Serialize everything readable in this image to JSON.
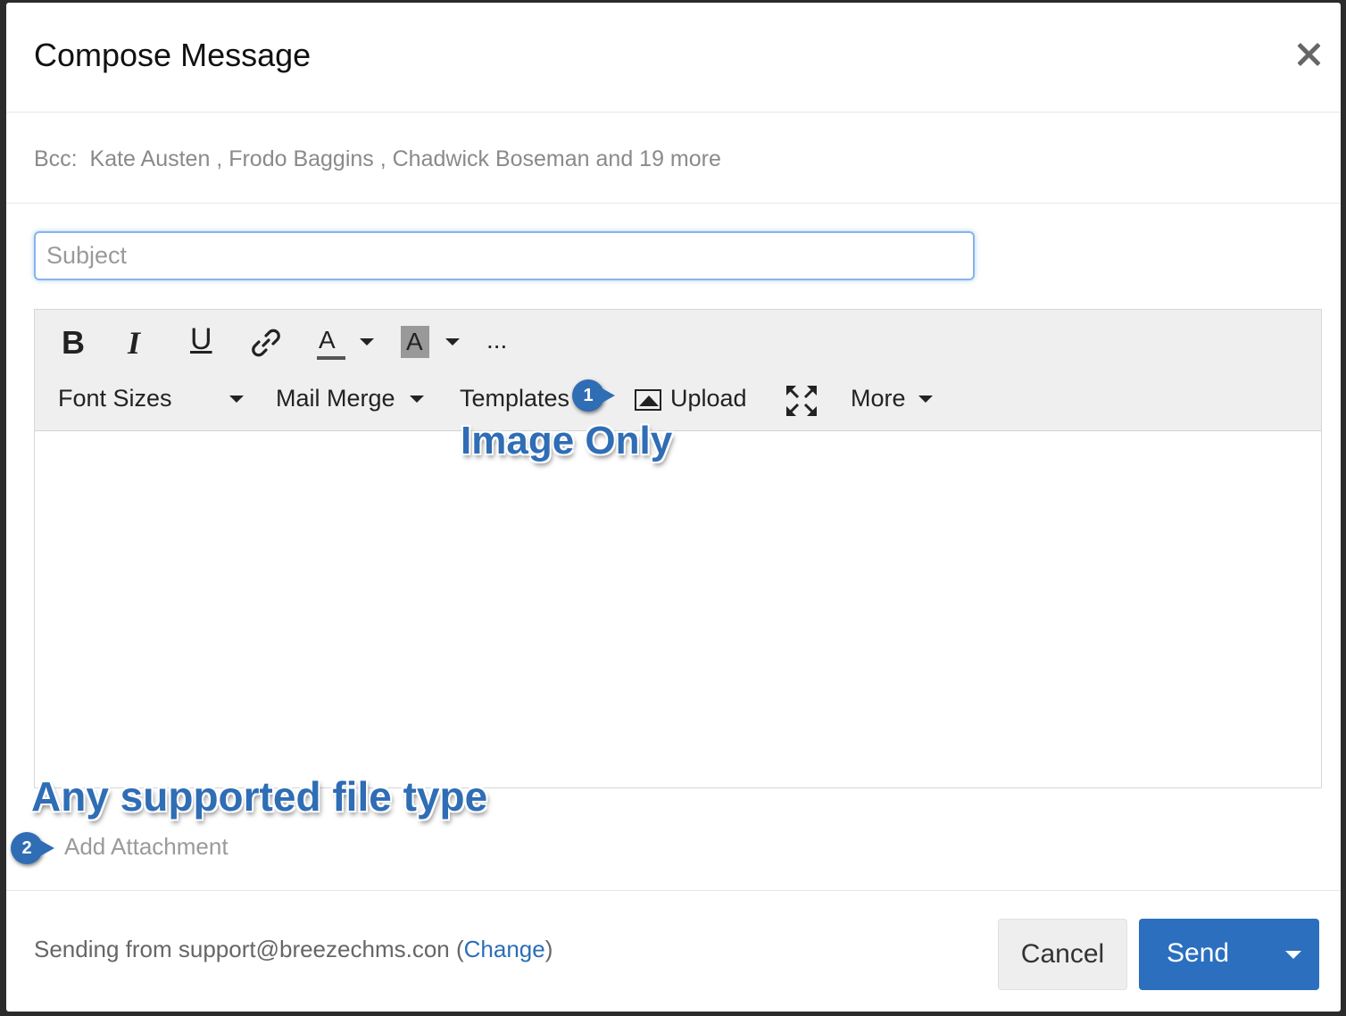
{
  "dialog": {
    "title": "Compose Message",
    "bcc_label": "Bcc:",
    "bcc_recipients_text": "Kate Austen , Frodo Baggins , Chadwick Boseman and 19 more"
  },
  "subject": {
    "placeholder": "Subject",
    "value": ""
  },
  "toolbar": {
    "bold": "B",
    "italic": "I",
    "underline": "U",
    "text_color": "A",
    "bg_color": "A",
    "ellipsis": "...",
    "font_sizes": "Font Sizes",
    "mail_merge": "Mail Merge",
    "templates": "Templates",
    "upload": "Upload",
    "more": "More"
  },
  "annotations": {
    "callout_1": {
      "number": "1",
      "text": "Image Only"
    },
    "callout_2": {
      "number": "2",
      "text": "Any supported file type"
    }
  },
  "attachment": {
    "label": "Add Attachment"
  },
  "footer": {
    "sending_prefix": "Sending from support@breezechms.con (",
    "change_link": "Change",
    "sending_suffix": ")",
    "cancel": "Cancel",
    "send": "Send"
  },
  "colors": {
    "accent": "#2b6fbe",
    "annotation": "#2f6db5"
  },
  "icons": [
    "close-icon",
    "link-icon",
    "image-icon",
    "fullscreen-icon",
    "caret-down-icon"
  ]
}
